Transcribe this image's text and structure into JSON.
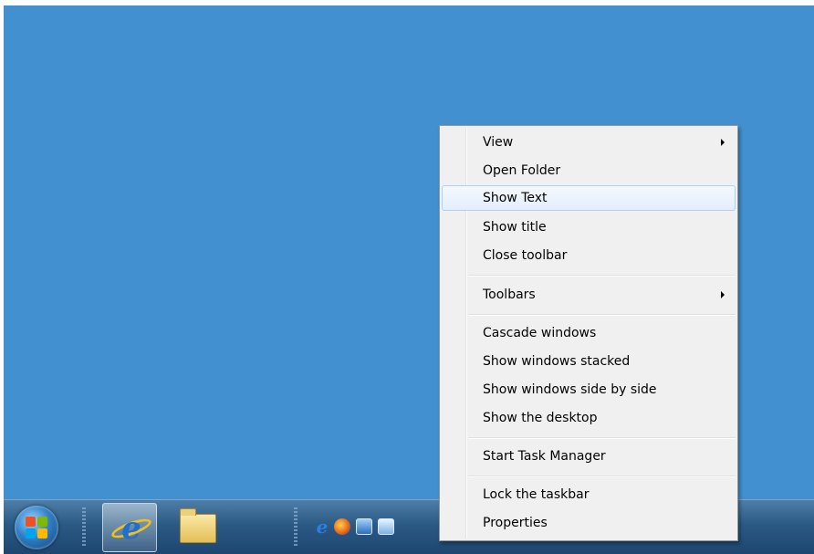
{
  "context_menu": {
    "items": [
      {
        "label": "View",
        "submenu": true
      },
      {
        "label": "Open Folder"
      },
      {
        "label": "Show Text",
        "highlighted": true
      },
      {
        "label": "Show title"
      },
      {
        "label": "Close toolbar"
      },
      {
        "label": "Toolbars",
        "submenu": true
      },
      {
        "label": "Cascade windows"
      },
      {
        "label": "Show windows stacked"
      },
      {
        "label": "Show windows side by side"
      },
      {
        "label": "Show the desktop"
      },
      {
        "label": "Start Task Manager"
      },
      {
        "label": "Lock the taskbar"
      },
      {
        "label": "Properties"
      }
    ]
  },
  "taskbar": {
    "start_button": {
      "icon": "windows-logo-icon"
    },
    "pinned": [
      {
        "icon": "internet-explorer-icon",
        "active": true
      },
      {
        "icon": "folder-icon",
        "active": false
      }
    ],
    "quick_launch": [
      "internet-explorer-icon",
      "firefox-icon",
      "desktop-icon",
      "switch-windows-icon"
    ]
  },
  "colors": {
    "desktop": "#4290cf",
    "menu_bg": "#f0f0f0",
    "highlight_border": "#aecff7"
  }
}
